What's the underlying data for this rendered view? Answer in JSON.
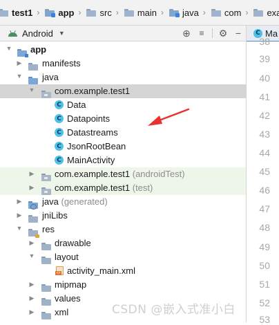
{
  "breadcrumb": [
    "test1",
    "app",
    "src",
    "main",
    "java",
    "com",
    "example"
  ],
  "toolbar": {
    "view_label": "Android",
    "icons": [
      "locate-icon",
      "collapse-icon",
      "gear-icon",
      "minimize-icon"
    ]
  },
  "editor": {
    "tab_label": "Ma",
    "line_numbers": [
      "38",
      "39",
      "40",
      "41",
      "42",
      "43",
      "44",
      "45",
      "46",
      "47",
      "48",
      "49",
      "50",
      "51",
      "52",
      "53"
    ]
  },
  "tree": [
    {
      "label": "app",
      "hint": "",
      "icon": "module",
      "expanded": true
    },
    {
      "label": "manifests",
      "hint": "",
      "icon": "folder",
      "expanded": false
    },
    {
      "label": "java",
      "hint": "",
      "icon": "source-folder",
      "expanded": true
    },
    {
      "label": "com.example.test1",
      "hint": "",
      "icon": "package",
      "expanded": true,
      "selected": true
    },
    {
      "label": "Data",
      "hint": "",
      "icon": "class"
    },
    {
      "label": "Datapoints",
      "hint": "",
      "icon": "class"
    },
    {
      "label": "Datastreams",
      "hint": "",
      "icon": "class"
    },
    {
      "label": "JsonRootBean",
      "hint": "",
      "icon": "class"
    },
    {
      "label": "MainActivity",
      "hint": "",
      "icon": "class"
    },
    {
      "label": "com.example.test1",
      "hint": "(androidTest)",
      "icon": "package",
      "expanded": false
    },
    {
      "label": "com.example.test1",
      "hint": "(test)",
      "icon": "package",
      "expanded": false
    },
    {
      "label": "java",
      "hint": "(generated)",
      "icon": "generated-folder",
      "expanded": false
    },
    {
      "label": "jniLibs",
      "hint": "",
      "icon": "folder",
      "expanded": false
    },
    {
      "label": "res",
      "hint": "",
      "icon": "resource-folder",
      "expanded": true
    },
    {
      "label": "drawable",
      "hint": "",
      "icon": "folder",
      "expanded": false
    },
    {
      "label": "layout",
      "hint": "",
      "icon": "folder",
      "expanded": true
    },
    {
      "label": "activity_main.xml",
      "hint": "",
      "icon": "xml-file"
    },
    {
      "label": "mipmap",
      "hint": "",
      "icon": "folder",
      "expanded": false
    },
    {
      "label": "values",
      "hint": "",
      "icon": "folder",
      "expanded": false
    },
    {
      "label": "xml",
      "hint": "",
      "icon": "folder",
      "expanded": false
    }
  ],
  "watermark": "CSDN @嵌入式准小白",
  "colors": {
    "selection": "#d5d5d5",
    "test_highlight": "#eef6e9",
    "class_icon": "#4fc1e9",
    "annotation_arrow": "#e8322d"
  }
}
